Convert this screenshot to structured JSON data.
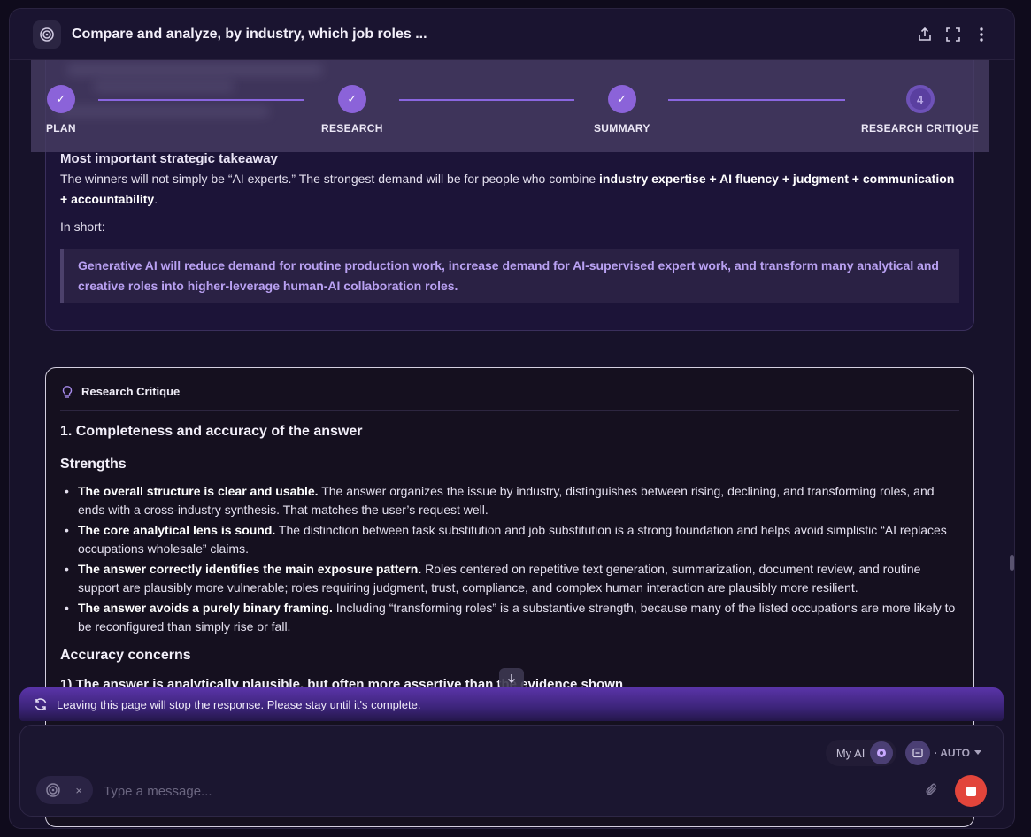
{
  "header": {
    "title": "Compare and analyze, by industry, which job roles ...",
    "icons": [
      "share-icon",
      "expand-icon",
      "more-icon"
    ]
  },
  "stepper": {
    "steps": [
      {
        "label": "PLAN",
        "status": "done",
        "marker": "✓"
      },
      {
        "label": "RESEARCH",
        "status": "done",
        "marker": "✓"
      },
      {
        "label": "SUMMARY",
        "status": "done",
        "marker": "✓"
      },
      {
        "label": "RESEARCH CRITIQUE",
        "status": "current",
        "marker": "4"
      }
    ]
  },
  "summary_card": {
    "heading": "Most important strategic takeaway",
    "paragraph_start": "The winners will not simply be “AI experts.” The strongest demand will be for people who combine ",
    "paragraph_bold": "industry expertise + AI fluency + judgment + communication + accountability",
    "paragraph_end": ".",
    "in_short": "In short:",
    "quote": "Generative AI will reduce demand for routine production work, increase demand for AI-supervised expert work, and transform many analytical and creative roles into higher-leverage human-AI collaboration roles."
  },
  "critique_card": {
    "title": "Research Critique",
    "section_heading": "1. Completeness and accuracy of the answer",
    "strengths_heading": "Strengths",
    "bullets": [
      {
        "bold": "The overall structure is clear and usable.",
        "text": " The answer organizes the issue by industry, distinguishes between rising, declining, and transforming roles, and ends with a cross-industry synthesis. That matches the user’s request well."
      },
      {
        "bold": "The core analytical lens is sound.",
        "text": " The distinction between task substitution and job substitution is a strong foundation and helps avoid simplistic “AI replaces occupations wholesale” claims."
      },
      {
        "bold": "The answer correctly identifies the main exposure pattern.",
        "text": " Roles centered on repetitive text generation, summarization, document review, and routine support are plausibly more vulnerable; roles requiring judgment, trust, compliance, and complex human interaction are plausibly more resilient."
      },
      {
        "bold": "The answer avoids a purely binary framing.",
        "text": " Including “transforming roles” is a substantive strength, because many of the listed occupations are more likely to be reconfigured than simply rise or fall."
      }
    ],
    "accuracy_heading": "Accuracy concerns",
    "sub_heading": "1) The answer is analytically plausible, but often more assertive than the evidence shown"
  },
  "banner": {
    "text": "Leaving this page will stop the response. Please stay until it's complete."
  },
  "composer": {
    "my_ai_label": "My AI",
    "auto_label": "· AUTO",
    "placeholder": "Type a message...",
    "tool_remove": "×"
  },
  "colors": {
    "accent": "#8b63d9",
    "stop": "#e2453b",
    "quote_text": "#b9a1f2"
  }
}
